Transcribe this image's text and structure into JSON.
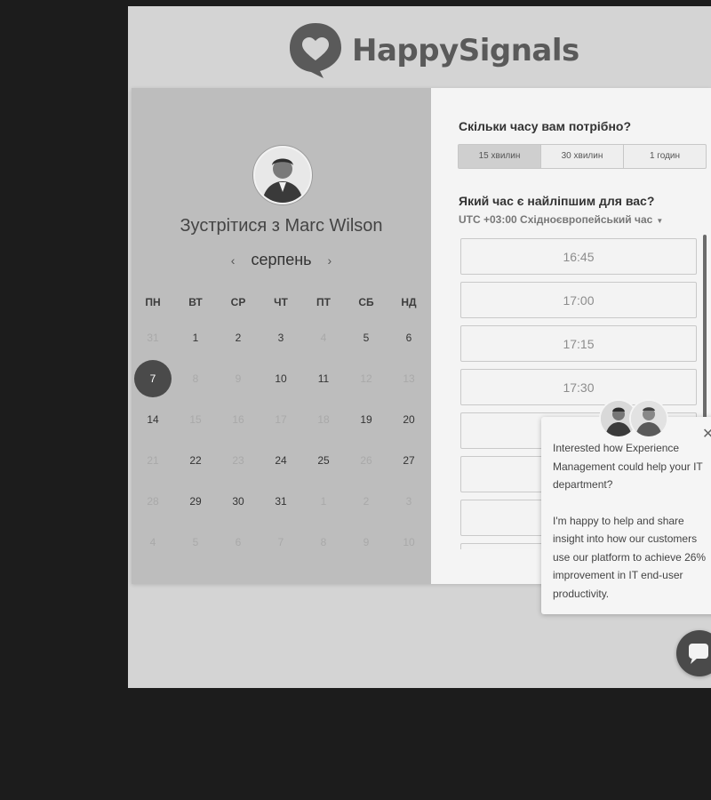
{
  "brand": {
    "name": "HappySignals",
    "logo_icon": "heart-speech-bubble-icon"
  },
  "host": {
    "title": "Зустрітися з Marc Wilson"
  },
  "calendar": {
    "month": "серпень",
    "prev_icon": "chevron-left-icon",
    "next_icon": "chevron-right-icon",
    "weekdays": [
      "ПН",
      "ВТ",
      "СР",
      "ЧТ",
      "ПТ",
      "СБ",
      "НД"
    ],
    "weeks": [
      [
        {
          "d": "31",
          "s": "dim"
        },
        {
          "d": "1",
          "s": "active"
        },
        {
          "d": "2",
          "s": "active"
        },
        {
          "d": "3",
          "s": "active"
        },
        {
          "d": "4",
          "s": "dim"
        },
        {
          "d": "5",
          "s": "active"
        },
        {
          "d": "6",
          "s": "active"
        }
      ],
      [
        {
          "d": "7",
          "s": "selected"
        },
        {
          "d": "8",
          "s": "dim"
        },
        {
          "d": "9",
          "s": "dim"
        },
        {
          "d": "10",
          "s": "active"
        },
        {
          "d": "11",
          "s": "active"
        },
        {
          "d": "12",
          "s": "dim"
        },
        {
          "d": "13",
          "s": "dim"
        }
      ],
      [
        {
          "d": "14",
          "s": "active"
        },
        {
          "d": "15",
          "s": "dim"
        },
        {
          "d": "16",
          "s": "dim"
        },
        {
          "d": "17",
          "s": "dim"
        },
        {
          "d": "18",
          "s": "dim"
        },
        {
          "d": "19",
          "s": "active"
        },
        {
          "d": "20",
          "s": "active"
        }
      ],
      [
        {
          "d": "21",
          "s": "dim"
        },
        {
          "d": "22",
          "s": "active"
        },
        {
          "d": "23",
          "s": "dim"
        },
        {
          "d": "24",
          "s": "active"
        },
        {
          "d": "25",
          "s": "active"
        },
        {
          "d": "26",
          "s": "dim"
        },
        {
          "d": "27",
          "s": "active"
        }
      ],
      [
        {
          "d": "28",
          "s": "dim"
        },
        {
          "d": "29",
          "s": "active"
        },
        {
          "d": "30",
          "s": "active"
        },
        {
          "d": "31",
          "s": "active"
        },
        {
          "d": "1",
          "s": "dim"
        },
        {
          "d": "2",
          "s": "dim"
        },
        {
          "d": "3",
          "s": "dim"
        }
      ],
      [
        {
          "d": "4",
          "s": "dim"
        },
        {
          "d": "5",
          "s": "dim"
        },
        {
          "d": "6",
          "s": "dim"
        },
        {
          "d": "7",
          "s": "dim"
        },
        {
          "d": "8",
          "s": "dim"
        },
        {
          "d": "9",
          "s": "dim"
        },
        {
          "d": "10",
          "s": "dim"
        }
      ]
    ]
  },
  "booking": {
    "duration_question": "Скільки часу вам потрібно?",
    "durations": [
      {
        "label": "15 хвилин",
        "selected": true
      },
      {
        "label": "30 хвилин",
        "selected": false
      },
      {
        "label": "1 годин",
        "selected": false
      }
    ],
    "time_question": "Який час є найліпшим для вас?",
    "timezone": "UTC +03:00 Східноєвропейський час",
    "timezone_icon": "caret-down-icon",
    "slots": [
      "16:45",
      "17:00",
      "17:15",
      "17:30",
      "",
      "",
      "",
      ""
    ]
  },
  "chat": {
    "message_p1": "Interested how Experience Management could help your IT department?",
    "message_p2": "I'm happy to help and share insight into how our customers use our platform to achieve 26% improvement in IT end-user productivity.",
    "close_icon": "close-icon",
    "launcher_icon": "chat-bubble-icon"
  },
  "colors": {
    "page_bg": "#1c1c1c",
    "panel_bg": "#bdbdbd",
    "selected_day": "#4a4a4a"
  }
}
